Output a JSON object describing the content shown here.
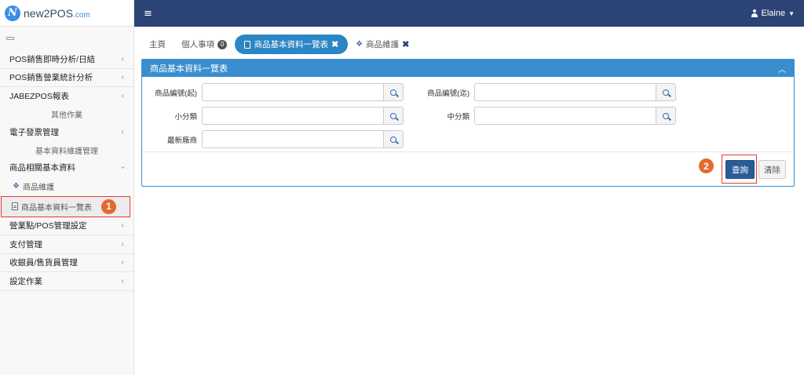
{
  "app": {
    "logo_text": "new2POS",
    "logo_suffix": ".com",
    "logo_letter": "N"
  },
  "topbar": {
    "user_name": "Elaine"
  },
  "sidebar": {
    "items": [
      {
        "label": "POS銷售即時分析/日結"
      },
      {
        "label": "POS銷售營業統計分析"
      },
      {
        "label": "JABEZPOS報表"
      },
      {
        "label": "其他作業"
      },
      {
        "label": "電子發票管理"
      },
      {
        "label": "基本資料維護管理"
      },
      {
        "label": "商品相關基本資料"
      },
      {
        "label": "商品維護"
      },
      {
        "label": "商品基本資料一覽表"
      },
      {
        "label": "營業點/POS管理設定"
      },
      {
        "label": "支付管理"
      },
      {
        "label": "收銀員/售貨員管理"
      },
      {
        "label": "設定作業"
      }
    ]
  },
  "tabs": [
    {
      "label": "主頁"
    },
    {
      "label": "個人事項",
      "badge": "0"
    },
    {
      "label": "商品基本資料一覽表"
    },
    {
      "label": "商品維護"
    }
  ],
  "panel": {
    "title": "商品基本資料一覽表",
    "fields": {
      "code_from": {
        "label": "商品編號(起)",
        "value": ""
      },
      "code_to": {
        "label": "商品編號(迄)",
        "value": ""
      },
      "sub_category": {
        "label": "小分類",
        "value": ""
      },
      "mid_category": {
        "label": "中分類",
        "value": ""
      },
      "latest_vendor": {
        "label": "最新廠商",
        "value": ""
      }
    },
    "query_label": "查詢",
    "clear_label": "清除"
  },
  "markers": {
    "one": "1",
    "two": "2"
  }
}
